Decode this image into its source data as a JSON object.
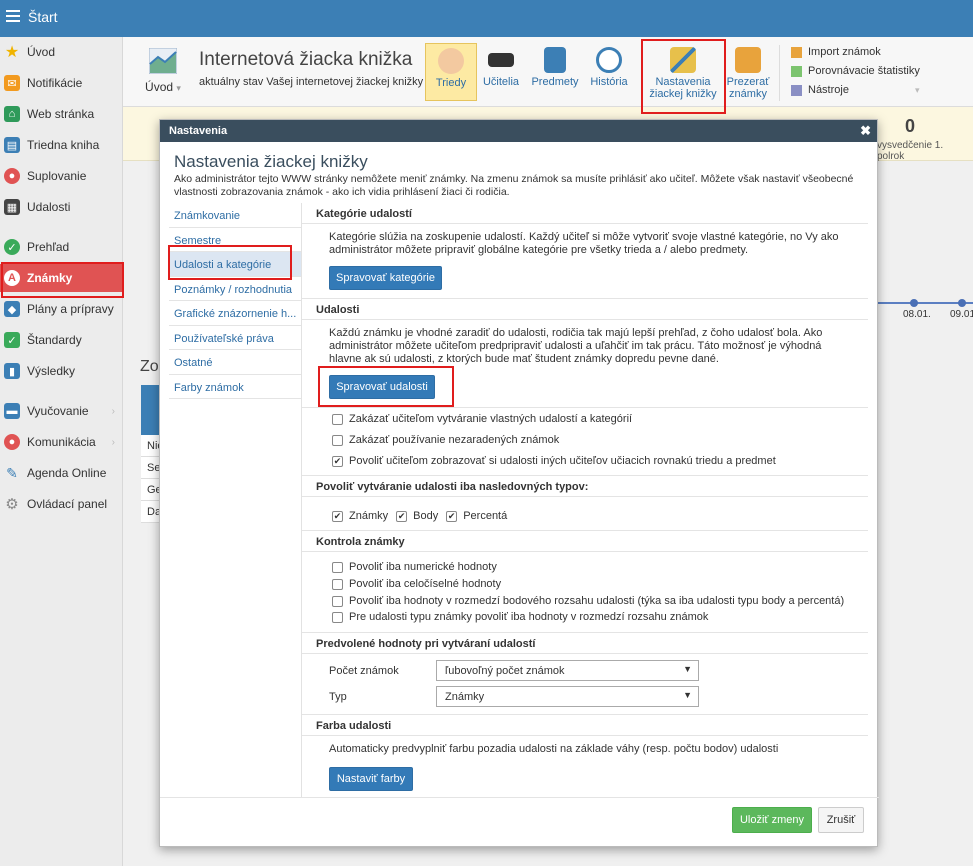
{
  "topbar": {
    "title": "Štart"
  },
  "sidebar": {
    "items": [
      {
        "label": "Úvod",
        "icon": "star-icon",
        "color": "#f0b400"
      },
      {
        "label": "Notifikácie",
        "icon": "envelope-icon",
        "color": "#f29a1f"
      },
      {
        "label": "Web stránka",
        "icon": "home-icon",
        "color": "#2f9a5a"
      },
      {
        "label": "Triedna kniha",
        "icon": "book-icon",
        "color": "#3c7fb5"
      },
      {
        "label": "Suplovanie",
        "icon": "person-icon",
        "color": "#e05353"
      },
      {
        "label": "Udalosti",
        "icon": "calendar-icon",
        "color": "#444444"
      },
      {
        "label": "Prehľad",
        "icon": "check-icon",
        "color": "#3aaa5a"
      },
      {
        "label": "Známky",
        "icon": "grade-icon",
        "color": "#e05353"
      },
      {
        "label": "Plány a prípravy",
        "icon": "cube-icon",
        "color": "#3c7fb5"
      },
      {
        "label": "Štandardy",
        "icon": "shield-icon",
        "color": "#3aaa5a"
      },
      {
        "label": "Výsledky",
        "icon": "bar-chart-icon",
        "color": "#3c7fb5"
      },
      {
        "label": "Vyučovanie",
        "icon": "classroom-icon",
        "color": "#3c7fb5"
      },
      {
        "label": "Komunikácia",
        "icon": "chat-icon",
        "color": "#e05353"
      },
      {
        "label": "Agenda Online",
        "icon": "pen-icon",
        "color": "#3c7fb5"
      },
      {
        "label": "Ovládací panel",
        "icon": "gear-icon",
        "color": "#888888"
      }
    ]
  },
  "toolbar": {
    "uvod": "Úvod",
    "title": "Internetová žiacka knižka",
    "subtitle": "aktuálny stav Vašej internetovej žiackej knižky",
    "buttons": [
      {
        "label": "Triedy",
        "icon": "class-icon"
      },
      {
        "label": "Učitelia",
        "icon": "graduation-cap-icon"
      },
      {
        "label": "Predmety",
        "icon": "subject-icon"
      },
      {
        "label": "História",
        "icon": "clock-icon"
      },
      {
        "label": "Nastavenia žiackej knižky",
        "line1": "Nastavenia",
        "line2": "žiackej knižky",
        "icon": "settings-pencil-icon"
      },
      {
        "label": "Prezerať známky",
        "line1": "Prezerať",
        "line2": "známky",
        "icon": "folder-icon"
      }
    ],
    "right": [
      "Import známok",
      "Porovnávacie štatistiky",
      "Nástroje"
    ]
  },
  "background": {
    "stat_value": "0",
    "stat_label": "vysvedčenie 1. polrok",
    "dates": [
      "08.01.",
      "09.01."
    ],
    "zo_heading": "Zo",
    "table_rows": [
      "Nie",
      "Se",
      "Ge",
      "Da"
    ]
  },
  "modal": {
    "header": "Nastavenia",
    "title": "Nastavenia žiackej knižky",
    "description": "Ako administrátor tejto WWW stránky nemôžete meniť známky. Na zmenu známok sa musíte prihlásiť ako učiteľ. Môžete však nastaviť všeobecné vlastnosti zobrazovania známok - ako ich vidia prihlásení žiaci či rodičia.",
    "nav": [
      "Známkovanie",
      "Semestre",
      "Udalosti a kategórie",
      "Poznámky / rozhodnutia",
      "Grafické znázornenie h...",
      "Používateľské práva",
      "Ostatné",
      "Farby známok"
    ],
    "sections": {
      "categories": {
        "title": "Kategórie udalostí",
        "text": "Kategórie slúžia na zoskupenie udalostí. Každý učiteľ si môže vytvoriť svoje vlastné kategórie, no Vy ako administrátor môžete pripraviť globálne kategórie pre všetky trieda a / alebo predmety.",
        "button": "Spravovať kategórie"
      },
      "events": {
        "title": "Udalosti",
        "text": "Každú známku je vhodné zaradiť do udalosti, rodičia tak majú lepší prehľad, z čoho udalosť bola. Ako administrátor môžete učiteľom predpripraviť udalosti a uľahčiť im tak prácu. Táto možnosť je výhodná hlavne ak sú udalosti, z ktorých bude mať študent známky dopredu pevne dané.",
        "button": "Spravovať udalosti",
        "checkboxes": [
          {
            "label": "Zakázať učiteľom vytváranie vlastných udalostí a kategórií",
            "checked": false
          },
          {
            "label": "Zakázať používanie nezaradených známok",
            "checked": false
          },
          {
            "label": "Povoliť učiteľom zobrazovať si udalosti iných učiteľov učiacich rovnakú triedu a predmet",
            "checked": true
          }
        ]
      },
      "types": {
        "title": "Povoliť vytváranie udalosti iba nasledovných typov:",
        "options": [
          {
            "label": "Známky",
            "checked": true
          },
          {
            "label": "Body",
            "checked": true
          },
          {
            "label": "Percentá",
            "checked": true
          }
        ]
      },
      "control": {
        "title": "Kontrola známky",
        "checkboxes": [
          {
            "label": "Povoliť iba numerické hodnoty",
            "checked": false
          },
          {
            "label": "Povoliť iba celočíselné hodnoty",
            "checked": false
          },
          {
            "label": "Povoliť iba hodnoty v rozmedzí bodového rozsahu udalosti (týka sa iba udalosti typu body a percentá)",
            "checked": false
          },
          {
            "label": "Pre udalosti typu známky povoliť iba hodnoty v rozmedzí rozsahu známok",
            "checked": false
          }
        ]
      },
      "defaults": {
        "title": "Predvolené hodnoty pri vytváraní udalostí",
        "count_label": "Počet známok",
        "count_value": "ľubovoľný počet známok",
        "type_label": "Typ",
        "type_value": "Známky"
      },
      "color": {
        "title": "Farba udalosti",
        "text": "Automaticky predvyplniť farbu pozadia udalosti na základe váhy (resp. počtu bodov) udalosti",
        "button": "Nastaviť farby"
      }
    },
    "save": "Uložiť zmeny",
    "cancel": "Zrušiť"
  }
}
